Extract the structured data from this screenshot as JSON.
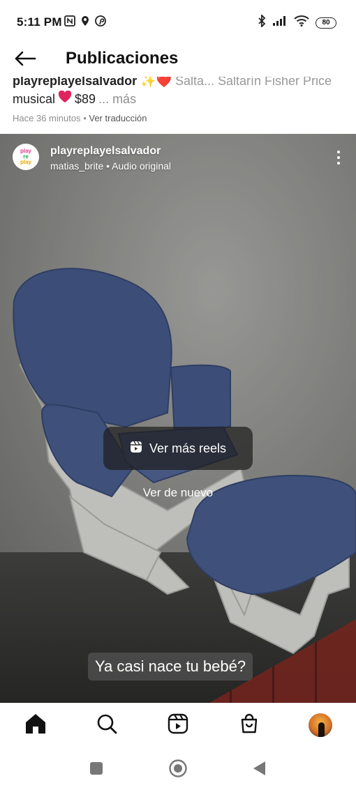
{
  "status_bar": {
    "time": "5:11 PM",
    "battery": "80",
    "left_icons": [
      "nfc-icon",
      "location-icon",
      "pinterest-icon"
    ],
    "right_icons": [
      "bluetooth-icon",
      "signal-icon",
      "wifi-icon",
      "battery-icon"
    ]
  },
  "header": {
    "title": "Publicaciones",
    "back_icon": "arrow-left-icon"
  },
  "previous_post": {
    "caption_user": "playreplayelsalvador",
    "caption_cut_text": "✨❤️ Salta... Saltarín Fisher Price",
    "caption_line2": "musical",
    "caption_price": "$89",
    "more_label": "... más",
    "time_ago": "Hace 36 minutos",
    "separator": "•",
    "translate_label": "Ver traducción"
  },
  "reel": {
    "avatar_text": [
      "play",
      "re",
      "play"
    ],
    "username": "playreplayelsalvador",
    "subline": "matias_brite • Audio original",
    "ver_mas_label": "Ver más reels",
    "ver_de_nuevo_label": "Ver de nuevo",
    "subtitle": "Ya casi nace tu bebé?"
  },
  "bottom_nav": {
    "items": [
      "home-icon",
      "search-icon",
      "reels-icon",
      "shop-icon",
      "profile-avatar"
    ]
  },
  "android_nav": {
    "items": [
      "recents-icon",
      "home-circle-icon",
      "back-triangle-icon"
    ]
  }
}
